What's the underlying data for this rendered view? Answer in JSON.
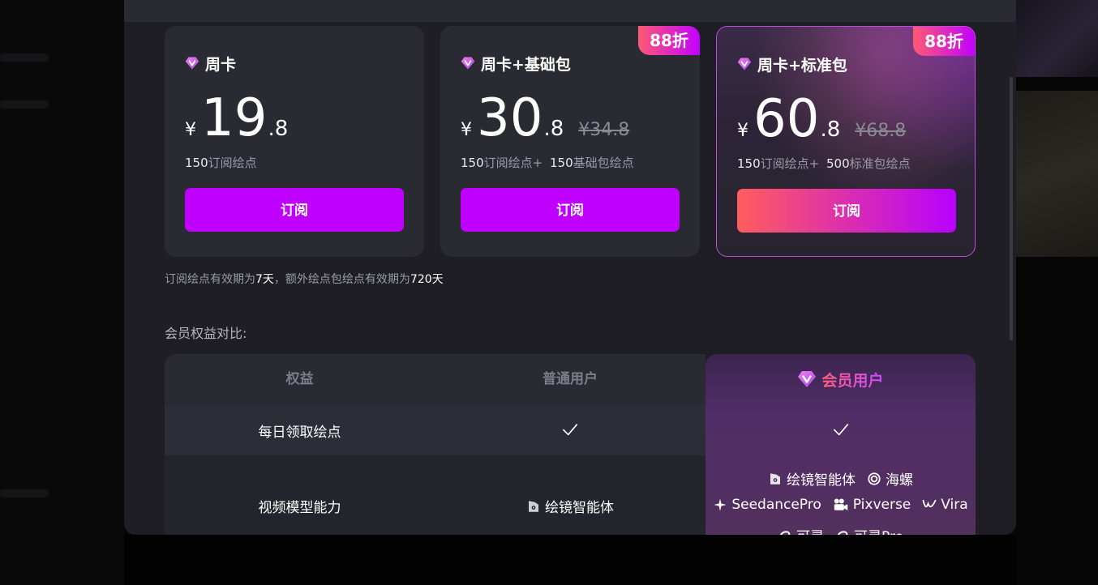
{
  "plans": [
    {
      "title": "周卡",
      "currency": "¥",
      "price_int": "19",
      "price_dec": ".8",
      "original_price": "",
      "badge": "",
      "points_num_1": "150",
      "points_label_1": "订阅绘点",
      "points_num_2": "",
      "points_label_2": "",
      "button": "订阅"
    },
    {
      "title": "周卡+基础包",
      "currency": "¥",
      "price_int": "30",
      "price_dec": ".8",
      "original_price": "¥34.8",
      "badge": "88折",
      "points_num_1": "150",
      "points_label_1": "订阅绘点+",
      "points_num_2": "150",
      "points_label_2": "基础包绘点",
      "button": "订阅"
    },
    {
      "title": "周卡+标准包",
      "currency": "¥",
      "price_int": "60",
      "price_dec": ".8",
      "original_price": "¥68.8",
      "badge": "88折",
      "points_num_1": "150",
      "points_label_1": "订阅绘点+",
      "points_num_2": "500",
      "points_label_2": "标准包绘点",
      "button": "订阅"
    }
  ],
  "validity": {
    "part1": "订阅绘点有效期为",
    "days1": "7天",
    "part2": "，额外绘点包绘点有效期为",
    "days2": "720天"
  },
  "comparison": {
    "title": "会员权益对比:",
    "headers": {
      "benefit": "权益",
      "normal": "普通用户",
      "vip": "会员用户"
    },
    "rows": [
      {
        "benefit": "每日领取绘点"
      },
      {
        "benefit": "视频模型能力",
        "normal_model": "绘镜智能体",
        "vip_models": {
          "line1": [
            "绘镜智能体",
            "海螺"
          ],
          "line2": [
            "SeedancePro",
            "Pixverse",
            "Vira"
          ],
          "line3": [
            "可灵",
            "可灵Pro"
          ]
        }
      }
    ]
  },
  "colors": {
    "accent_purple": "#c000ff",
    "gradient_start": "#ff5e5e",
    "gradient_end": "#b800ff",
    "modal_bg": "#1e1e24",
    "card_bg": "#2a2a33"
  }
}
